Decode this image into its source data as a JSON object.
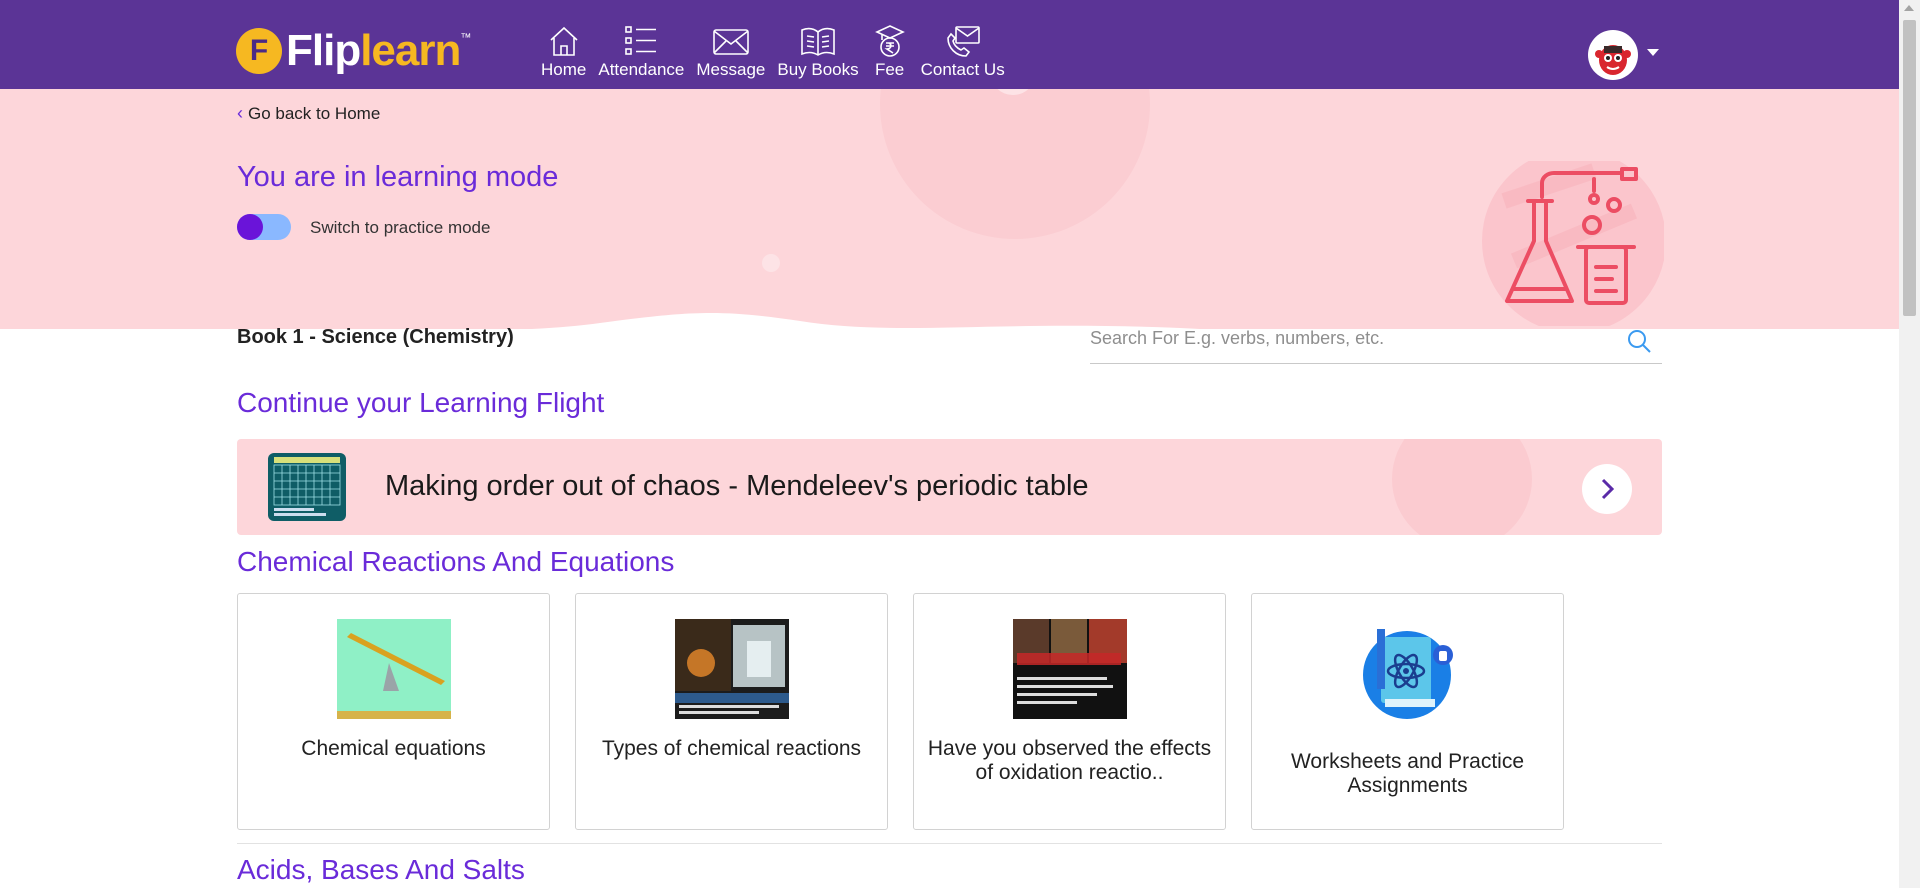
{
  "brand": {
    "name_part1": "Flip",
    "name_part2": "learn",
    "tm": "™",
    "badge_letter": "F"
  },
  "nav": [
    {
      "label": "Home",
      "icon": "home-icon"
    },
    {
      "label": "Attendance",
      "icon": "list-icon"
    },
    {
      "label": "Message",
      "icon": "envelope-icon"
    },
    {
      "label": "Buy Books",
      "icon": "book-icon"
    },
    {
      "label": "Fee",
      "icon": "graduate-rupee-icon"
    },
    {
      "label": "Contact Us",
      "icon": "phone-envelope-icon"
    }
  ],
  "hero": {
    "back_link": "Go back to Home",
    "mode_title": "You are in learning mode",
    "toggle_label": "Switch to practice mode"
  },
  "book": {
    "title": "Book 1 - Science (Chemistry)"
  },
  "search": {
    "placeholder": "Search For E.g. verbs, numbers, etc.",
    "value": ""
  },
  "continue": {
    "heading": "Continue your Learning Flight",
    "title": "Making order out of chaos - Mendeleev's periodic table"
  },
  "sections": [
    {
      "heading": "Chemical Reactions And Equations",
      "cards": [
        {
          "title": "Chemical equations"
        },
        {
          "title": "Types of chemical reactions"
        },
        {
          "title": "Have you observed the effects of oxidation reactio.."
        },
        {
          "title": "Worksheets and Practice Assignments"
        }
      ]
    },
    {
      "heading": "Acids, Bases And Salts"
    }
  ],
  "colors": {
    "topbar": "#5b3496",
    "accent": "#6a2bd9",
    "hero_bg": "#fdd6da",
    "logo_yellow": "#f6b821"
  }
}
